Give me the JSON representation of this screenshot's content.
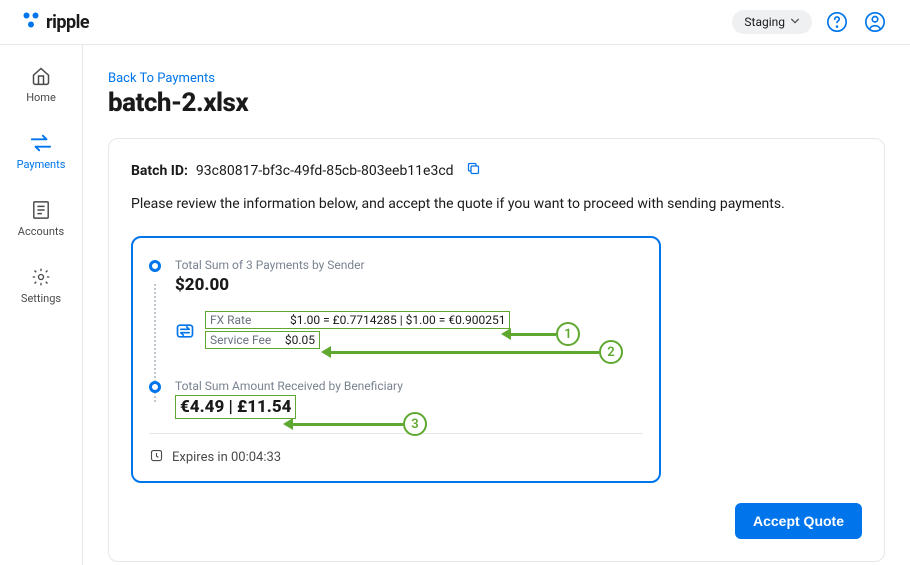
{
  "header": {
    "brand": "ripple",
    "env_label": "Staging"
  },
  "sidebar": {
    "items": [
      {
        "label": "Home"
      },
      {
        "label": "Payments"
      },
      {
        "label": "Accounts"
      },
      {
        "label": "Settings"
      }
    ]
  },
  "page": {
    "back_link": "Back To Payments",
    "title": "batch-2.xlsx",
    "batch_id_label": "Batch ID:",
    "batch_id": "93c80817-bf3c-49fd-85cb-803eeb11e3cd",
    "instruction": "Please review the information below, and accept the quote if you want to proceed with sending payments."
  },
  "quote": {
    "sender_label": "Total Sum of 3 Payments by Sender",
    "sender_amount": "$20.00",
    "fx_rate_key": "FX Rate",
    "fx_rate_val": "$1.00 = £0.7714285 | $1.00 = €0.900251",
    "fee_key": "Service Fee",
    "fee_val": "$0.05",
    "beneficiary_label": "Total Sum Amount Received by Beneficiary",
    "beneficiary_amount": "€4.49 | £11.54",
    "expires_label": "Expires in 00:04:33"
  },
  "annotations": {
    "a1": "1",
    "a2": "2",
    "a3": "3"
  },
  "actions": {
    "accept": "Accept Quote"
  }
}
